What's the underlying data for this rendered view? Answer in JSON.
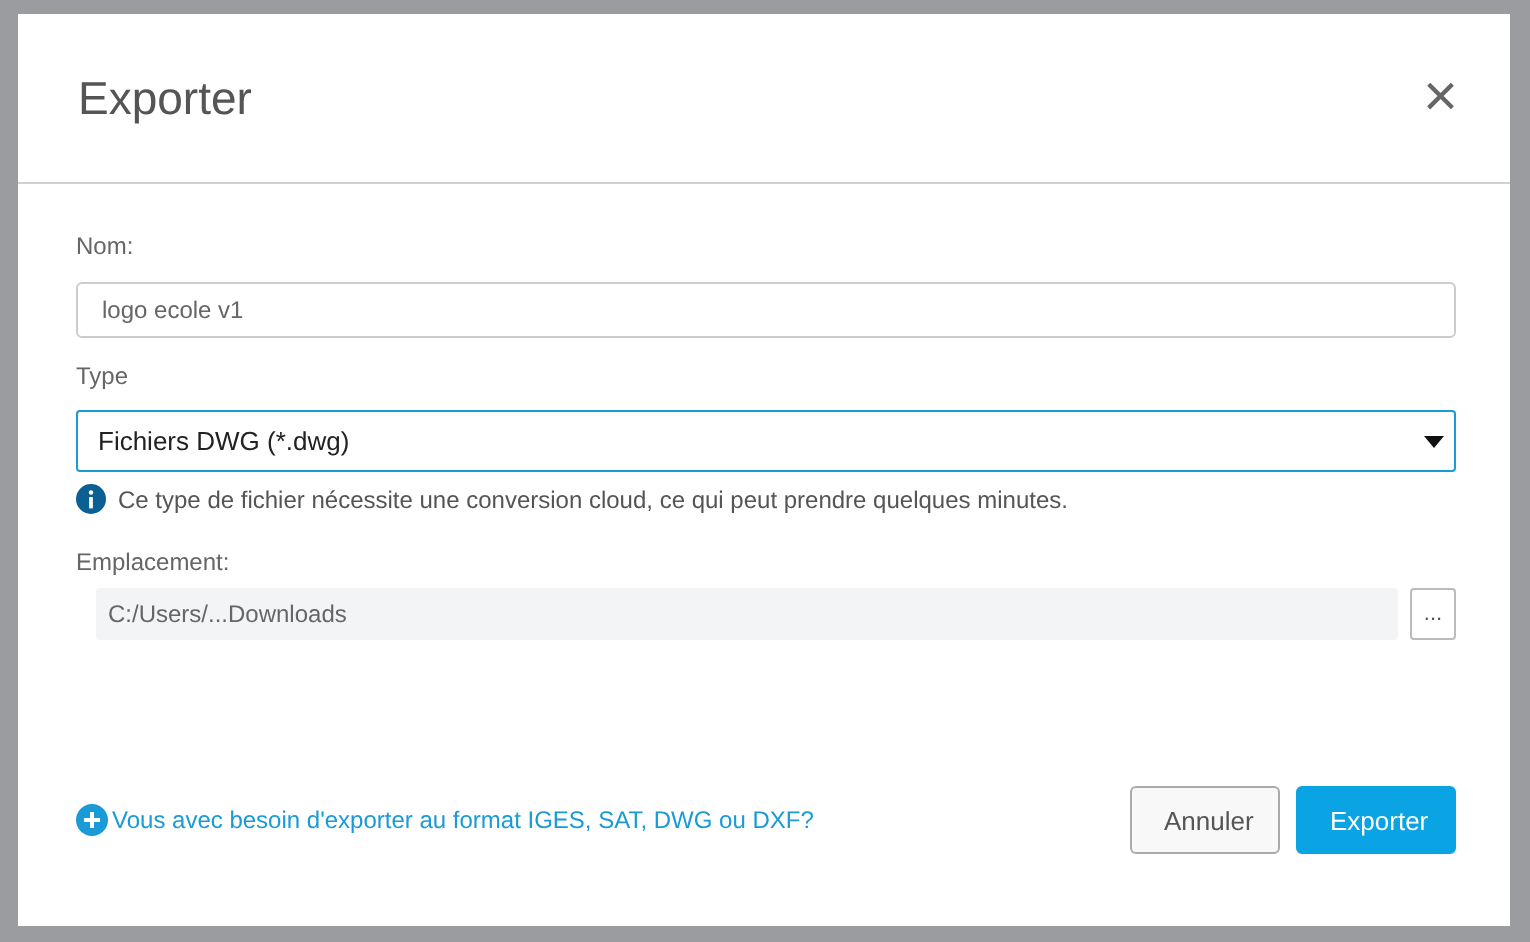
{
  "dialog": {
    "title": "Exporter",
    "close_icon": "×"
  },
  "name_field": {
    "label": "Nom:",
    "value": "logo ecole v1"
  },
  "type_field": {
    "label": "Type",
    "value": "Fichiers DWG (*.dwg)",
    "focused": true
  },
  "info": "Ce type de fichier nécessite une conversion cloud, ce qui peut prendre quelques minutes.",
  "location": {
    "label": "Emplacement:",
    "value": "C:/Users/...Downloads",
    "browse": "..."
  },
  "help_link": "Vous avec besoin d'exporter au format IGES, SAT, DWG ou DXF?",
  "buttons": [
    {
      "label": "Annuler",
      "kind": "secondary"
    },
    {
      "label": "Exporter",
      "kind": "primary"
    }
  ]
}
